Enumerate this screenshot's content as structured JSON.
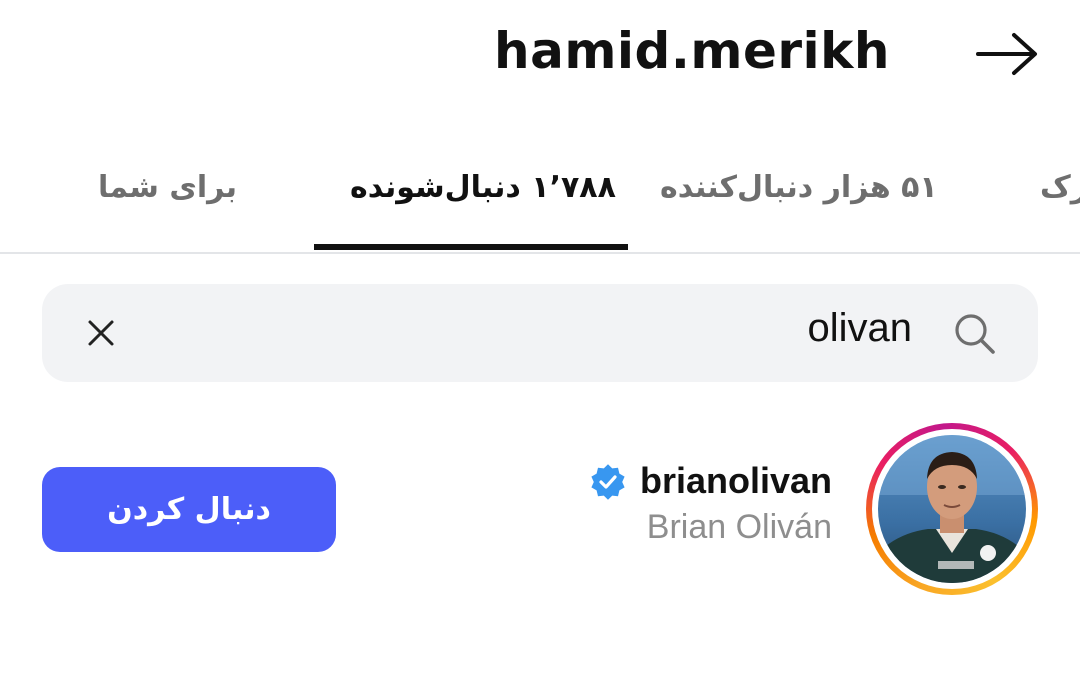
{
  "header": {
    "title": "hamid.merikh",
    "back_icon": "arrow-right-icon"
  },
  "tabs": [
    {
      "label": "برای شما",
      "active": false
    },
    {
      "label": "۱٬۷۸۸ دنبال‌شونده",
      "active": true
    },
    {
      "label": "۵۱ هزار دنبال‌کننده",
      "active": false
    },
    {
      "label": "رک",
      "active": false
    }
  ],
  "search": {
    "value": "olivan",
    "search_icon": "search-icon",
    "clear_icon": "close-icon"
  },
  "results": [
    {
      "username": "brianolivan",
      "full_name": "Brian Oliván",
      "verified": true,
      "button_label": "دنبال کردن"
    }
  ],
  "colors": {
    "accent": "#4c5ef9",
    "verified": "#3897f0",
    "search_bg": "#f2f3f5",
    "secondary_text": "#8e8e8e"
  }
}
